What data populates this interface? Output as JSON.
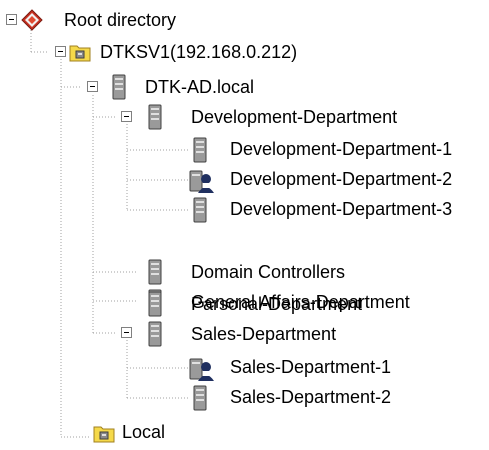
{
  "tree": {
    "root": {
      "label": "Root directory",
      "icon": "root-diamond-icon",
      "expanded": true
    },
    "server": {
      "label": "DTKSV1(192.168.0.212)",
      "icon": "server-folder-icon",
      "expanded": true
    },
    "domain": {
      "label": "DTK-AD.local",
      "icon": "domain-server-icon",
      "expanded": true
    },
    "dev_dept": {
      "label": "Development-Department",
      "icon": "ou-server-icon",
      "expanded": true
    },
    "dev_1": {
      "label": "Development-Department-1",
      "icon": "ou-server-icon"
    },
    "dev_2": {
      "label": "Development-Department-2",
      "icon": "ou-user-icon"
    },
    "dev_3": {
      "label": "Development-Department-3",
      "icon": "ou-server-icon"
    },
    "domain_controllers": {
      "label": "Domain Controllers",
      "icon": "ou-server-icon"
    },
    "general_affairs": {
      "label": "General Affairs-Department",
      "icon": "ou-server-icon"
    },
    "parsonal": {
      "label": "Parsonal-Department",
      "icon": "ou-server-icon"
    },
    "sales_dept": {
      "label": "Sales-Department",
      "icon": "ou-server-icon",
      "expanded": true
    },
    "sales_1": {
      "label": "Sales-Department-1",
      "icon": "ou-user-icon"
    },
    "sales_2": {
      "label": "Sales-Department-2",
      "icon": "ou-server-icon"
    },
    "local": {
      "label": "Local",
      "icon": "local-folder-icon"
    }
  },
  "colors": {
    "tree_line": "#a0a0a0",
    "folder_yellow": "#f5d94a",
    "server_gray": "#9a9a9a",
    "diamond_red": "#c83020"
  }
}
